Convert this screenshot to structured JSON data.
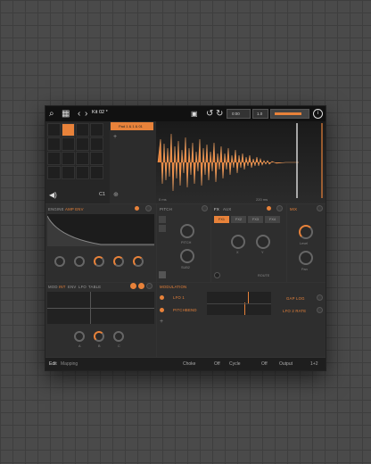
{
  "colors": {
    "accent": "#e8823a",
    "panel": "#2e2e2e",
    "bg": "#4a4a4a"
  },
  "toolbar": {
    "kit_name": "Kit 02 *",
    "undo_icon": "undo-icon",
    "redo_icon": "redo-icon",
    "tempo": "0:00",
    "sig": "1.0",
    "info_icon": "info-icon"
  },
  "pads": {
    "selected_pad": "Pad 1 & 1 & 01",
    "note": "C1",
    "add": "+"
  },
  "waveform": {
    "start_label": "0 ms",
    "end_label": "220 ms"
  },
  "envelope": {
    "tabs": [
      "ENGINE",
      "AMP ENV"
    ]
  },
  "pitch": {
    "title": "PITCH",
    "knob1": "PITCH",
    "knob2": "SUB2"
  },
  "fx": {
    "tabs": [
      "FX",
      "AUX"
    ],
    "slots": [
      "FX1",
      "FX2",
      "FX3",
      "FX4"
    ],
    "labels": [
      "X",
      "Y"
    ],
    "route": "ROUTE"
  },
  "mix": {
    "title": "MIX",
    "knob1": "Level",
    "knob2": "Pan"
  },
  "lfo": {
    "tabs": [
      "MOD",
      "INT",
      "ENV",
      "LFO",
      "TABLE"
    ],
    "knob_labels": [
      "A",
      "B",
      "C"
    ]
  },
  "modulation": {
    "title": "MODULATION",
    "sources": [
      "LFO 1",
      "PITCHBEND"
    ],
    "targets": [
      "GAP LOG",
      "LFO 2 RATE"
    ]
  },
  "footer": {
    "edit": "Edit",
    "mapping": "Mapping",
    "choke": "Choke",
    "choke_val": "Off",
    "cycle": "Cycle",
    "cycle_val": "Off",
    "output": "Output",
    "output_val": "1+2"
  }
}
